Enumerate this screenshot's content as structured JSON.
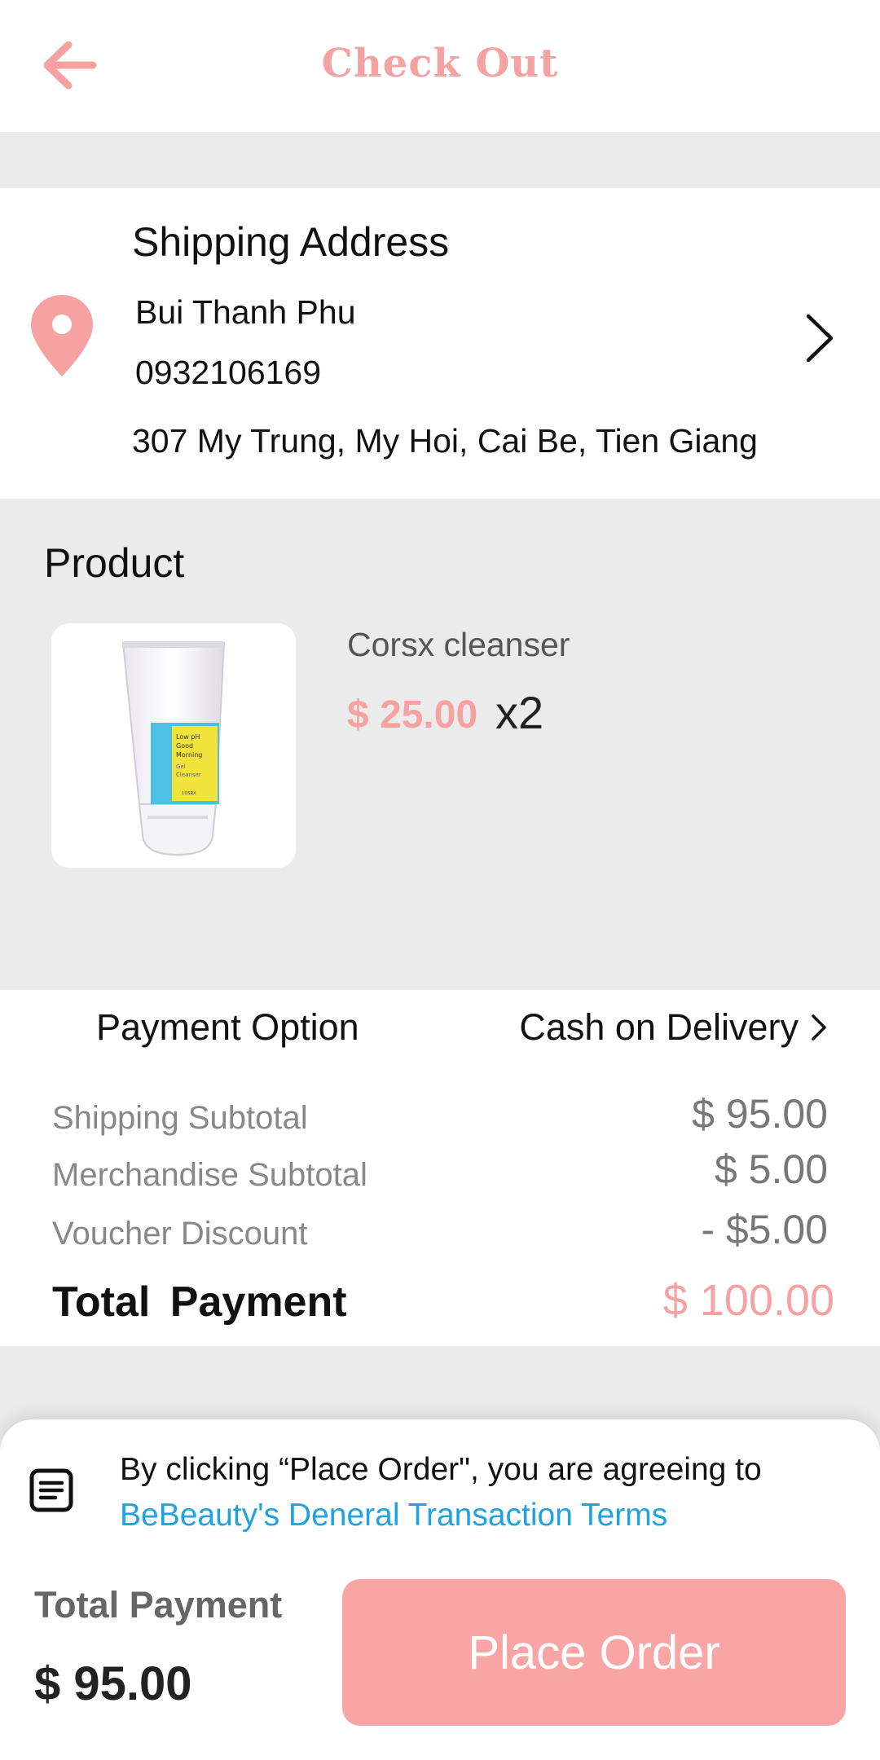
{
  "header": {
    "title": "Check Out",
    "back_icon": "arrow-left-icon",
    "accent_color": "#f7a2a2"
  },
  "shipping": {
    "title": "Shipping Address",
    "name": "Bui Thanh Phu",
    "phone": "0932106169",
    "address": "307 My Trung, My Hoi, Cai Be, Tien Giang",
    "pin_icon": "map-pin-icon",
    "chevron_icon": "chevron-right-icon"
  },
  "product": {
    "heading": "Product",
    "name": "Corsx cleanser",
    "price": "$ 25.00",
    "quantity": "x2",
    "image_label": "Low pH Good Morning Gel Cleanser"
  },
  "payment": {
    "label": "Payment Option",
    "value": "Cash on Delivery"
  },
  "summary": {
    "shipping_subtotal_label": "Shipping Subtotal",
    "shipping_subtotal_value": "$ 95.00",
    "merchandise_subtotal_label": "Merchandise Subtotal",
    "merchandise_subtotal_value": "$ 5.00",
    "voucher_label": "Voucher Discount",
    "voucher_value": "- $5.00",
    "total_label": "Total Payment",
    "total_value": "$ 100.00"
  },
  "bottom": {
    "terms_prefix": "By clicking “Place Order\", you are agreeing to",
    "terms_link": "BeBeauty's Deneral Transaction Terms",
    "total_label": "Total Payment",
    "total_value": "$ 95.00",
    "place_order_label": "Place Order",
    "link_color": "#1fa3e0",
    "button_color": "#f9a5a5"
  }
}
